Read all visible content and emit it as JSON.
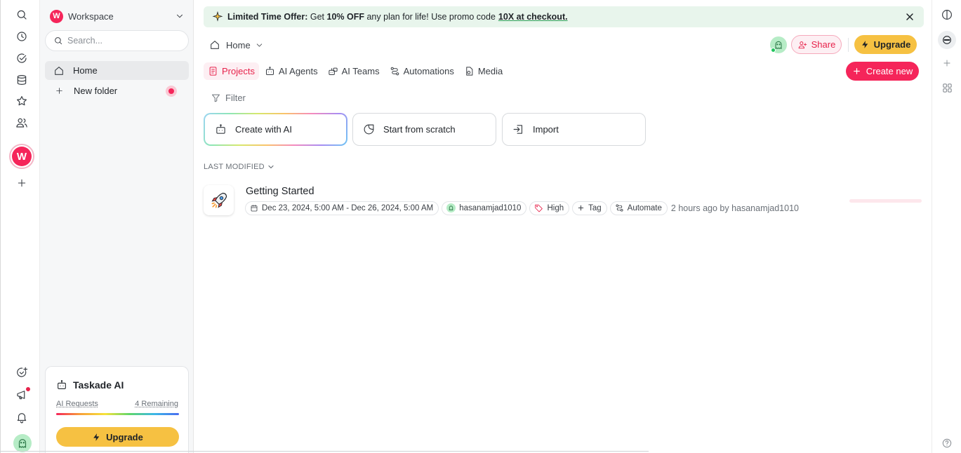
{
  "workspace": {
    "name": "Workspace",
    "initial": "W"
  },
  "sidebar": {
    "search_placeholder": "Search...",
    "items": [
      {
        "label": "Home"
      },
      {
        "label": "New folder"
      }
    ]
  },
  "ai_card": {
    "title": "Taskade AI",
    "requests_label": "AI Requests",
    "remaining_label": "4 Remaining",
    "upgrade_label": "Upgrade"
  },
  "banner": {
    "lead": "Limited Time Offer:",
    "text_1": "Get",
    "discount": "10% OFF",
    "text_2": "any plan for life! Use promo code",
    "promo": "10X at checkout."
  },
  "header": {
    "breadcrumb": "Home",
    "share_label": "Share",
    "upgrade_label": "Upgrade"
  },
  "tabs": [
    {
      "label": "Projects",
      "active": true
    },
    {
      "label": "AI Agents"
    },
    {
      "label": "AI Teams"
    },
    {
      "label": "Automations"
    },
    {
      "label": "Media"
    }
  ],
  "create_new_label": "Create new",
  "filter_label": "Filter",
  "actions": [
    {
      "label": "Create with AI"
    },
    {
      "label": "Start from scratch"
    },
    {
      "label": "Import"
    }
  ],
  "sort_label": "LAST MODIFIED",
  "project": {
    "title": "Getting Started",
    "date_range": "Dec 23, 2024, 5:00 AM - Dec 26, 2024, 5:00 AM",
    "assignee": "hasanamjad1010",
    "priority": "High",
    "tag_label": "Tag",
    "automate_label": "Automate",
    "modified": "2 hours ago by hasanamjad1010"
  },
  "colors": {
    "brand": "#f5255a",
    "upgrade": "#f6c142",
    "banner_bg": "#e8f5ec"
  },
  "icons": {
    "rail": [
      "search-icon",
      "clock-icon",
      "check-circle-icon",
      "archive-icon",
      "star-icon",
      "users-icon",
      "plus-icon"
    ],
    "rail_bottom": [
      "add-task-icon",
      "megaphone-icon",
      "bell-icon",
      "avatar-icon"
    ],
    "right_rail": [
      "panel-toggle-icon",
      "chat-icon",
      "plus-icon",
      "apps-grid-icon",
      "help-icon"
    ]
  }
}
